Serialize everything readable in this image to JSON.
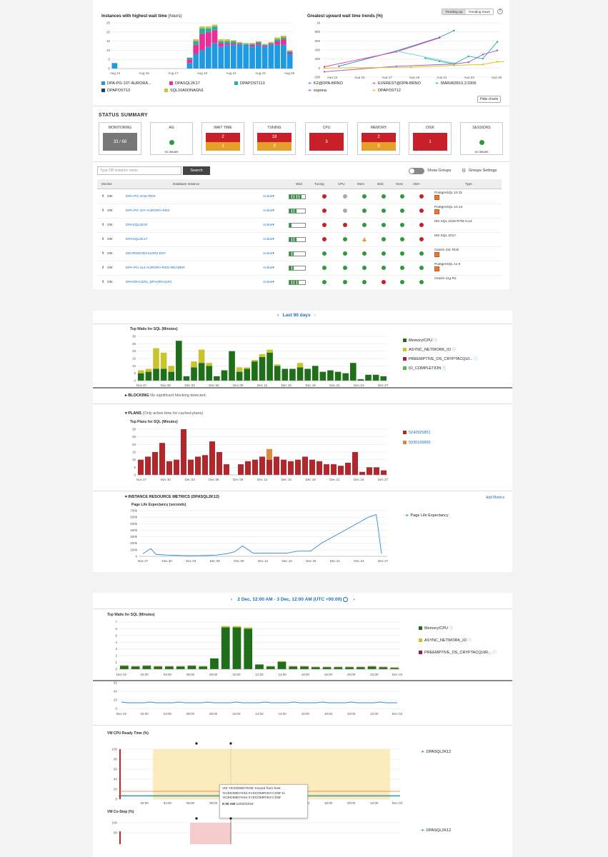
{
  "panel1": {
    "chart1": {
      "title": "Instances with highest wait time",
      "unit": "(hours)",
      "xlabels": [
        "Aug 13",
        "Aug 15",
        "Aug 17",
        "Aug 19",
        "Aug 21",
        "Aug 23",
        "Aug 25"
      ],
      "ylabels": [
        "25",
        "20",
        "15",
        "10",
        "5",
        "0"
      ]
    },
    "chart2": {
      "title": "Greatest upward wait time trends (%)",
      "xlabels": [
        "Aug 13",
        "Aug 15",
        "Aug 17",
        "Aug 19",
        "Aug 21",
        "Aug 23",
        "Aug 25"
      ],
      "ylabels": [
        "1k",
        "800",
        "600",
        "400",
        "200",
        "0",
        "-200"
      ]
    },
    "toggle": {
      "up": "Trending Up",
      "down": "Trending Down",
      "help": "?"
    },
    "legend1": [
      "DPA-PG-107-AURORA...",
      "DPASQL2K17",
      "DPAPOST113",
      "DPAPOST13",
      "SQL16AIIONAGN1"
    ],
    "legend2": [
      "K2@DPA-BRNO",
      "EVEREST@DPA-BRNO",
      "MARIADB10.2:3306",
      "espona",
      "DPAPOST12"
    ],
    "hide_charts": "Hide charts",
    "status_title": "STATUS SUMMARY",
    "cards": {
      "monitoring": {
        "label": "MONITORING",
        "value": "33 / 68"
      },
      "ag": {
        "label": "AG",
        "sub": "no issues"
      },
      "wait": {
        "label": "WAIT TIME",
        "top": "2",
        "bottom": "1"
      },
      "tuning": {
        "label": "TUNING",
        "top": "18",
        "bottom": "3"
      },
      "cpu": {
        "label": "CPU",
        "value": "3"
      },
      "memory": {
        "label": "MEMORY",
        "top": "2",
        "bottom": "9"
      },
      "disk": {
        "label": "DISK",
        "value": "1"
      },
      "sessions": {
        "label": "SESSIONS",
        "sub": "no issues"
      }
    },
    "search_placeholder": "Type DB instance name",
    "search_btn": "Search",
    "show_groups": "Show Groups",
    "groups_settings": "Groups Settings",
    "headers": {
      "monitor": "Monitor",
      "db": "Database Instance",
      "wait": "Wait",
      "tuning": "Tuning",
      "cpu": "CPU",
      "mem": "Mem",
      "disk": "Disk",
      "sess": "Sess",
      "alert": "Alert",
      "type": "Type"
    },
    "rows": [
      {
        "on": "ON",
        "name": "DPA-PG-1011-RDS",
        "action": "Action",
        "type": "PostgreSQL 10.11"
      },
      {
        "on": "ON",
        "name": "DPA-PG-107-AURORA-RDS",
        "action": "Action",
        "type": "PostgreSQL 10.14"
      },
      {
        "on": "ON",
        "name": "DPASQL2019",
        "action": "Action",
        "type": "MS SQL 2019 RTM CU4"
      },
      {
        "on": "ON",
        "name": "DPASQL2K17",
        "action": "Action",
        "type": "MS SQL 2017"
      },
      {
        "on": "ON",
        "name": "DEVRDSORA11GR2-ENT",
        "action": "Action",
        "type": "Oracle 19c RU9"
      },
      {
        "on": "ON",
        "name": "DPA-PG-114-AURORA-RDS-READER",
        "action": "Action",
        "type": "PostgreSQL 11.9"
      },
      {
        "on": "ON",
        "name": "DPAORA11R1_DPAORA11R1",
        "action": "Action",
        "type": "Oracle 11g R1"
      }
    ]
  },
  "panel2": {
    "range": "Last 90 days",
    "waits_title": "Top Waits for SQL (Minutes)",
    "xlabels": [
      "Nov 27",
      "Nov 30",
      "Dec 03",
      "Dec 06",
      "Dec 09",
      "Dec 12",
      "Dec 15",
      "Dec 18",
      "Dec 21",
      "Dec 24",
      "Dec 27"
    ],
    "waits_y": [
      "30",
      "25",
      "20",
      "15",
      "10",
      "5",
      "0"
    ],
    "waits_legend": [
      "Memory/CPU",
      "ASYNC_NETWORK_IO",
      "PREEMPTIVE_OS_CRYPTACQUI...",
      "IO_COMPLETION"
    ],
    "blocking": "BLOCKING",
    "blocking_note": "No significant blocking detected.",
    "plans": "PLANS",
    "plans_note": "(Only active time for cached plans)",
    "plans_title": "Top Plans for SQL (Minutes)",
    "plans_y": [
      "30",
      "25",
      "20",
      "15",
      "10",
      "5",
      "0"
    ],
    "plans_legend": [
      "5242925851",
      "5930106865"
    ],
    "irm": "INSTANCE RESOURCE METRICS (DPASQL2K12)",
    "add_metrics": "Add Metrics",
    "ple_title": "Page Life Expectancy (seconds)",
    "ple_y": [
      "700k",
      "600k",
      "500k",
      "400k",
      "300k",
      "200k",
      "100k",
      "0"
    ],
    "ple_legend": "Page Life Expectancy"
  },
  "panel3": {
    "range": "2 Dec, 12:00 AM - 3 Dec, 12:00 AM (UTC +00:00)",
    "waits_title": "Top Waits for SQL (Minutes)",
    "xlabels": [
      "Dec 02",
      "02:00",
      "04:00",
      "06:00",
      "08:00",
      "10:00",
      "12:00",
      "14:00",
      "16:00",
      "18:00",
      "20:00",
      "22:00",
      "Dec 03"
    ],
    "waits_y": [
      "7",
      "6",
      "5",
      "4",
      "3",
      "2",
      "1",
      "0"
    ],
    "waits_legend": [
      "Memory/CPU",
      "ASYNC_NETWORK_IO",
      "PREEMPTIVE_OS_CRYPTACQUIR..."
    ],
    "mid_y": [
      "60",
      "40",
      "20",
      "0"
    ],
    "vm_title": "VM CPU Ready Time (%)",
    "vm_y": [
      "100",
      "80",
      "60",
      "40",
      "20",
      "0"
    ],
    "vm_legend": "DPASQL2K12",
    "tip_line1": "VM 'HCEDIMDYK05' moved from host",
    "tip_line2": "'HCEDIMDYK03.XYZCOMPANY.COM' to",
    "tip_line3": "'HCEDIMDYK04.XYZCOMPANY.COM'",
    "tip_time": "9:30 AM",
    "tip_date": "12/02/2019",
    "costop_title": "VM Co-Stop (%)",
    "costop_y": [
      "100",
      "80"
    ],
    "costop_legend": "DPASQL2K12"
  }
}
